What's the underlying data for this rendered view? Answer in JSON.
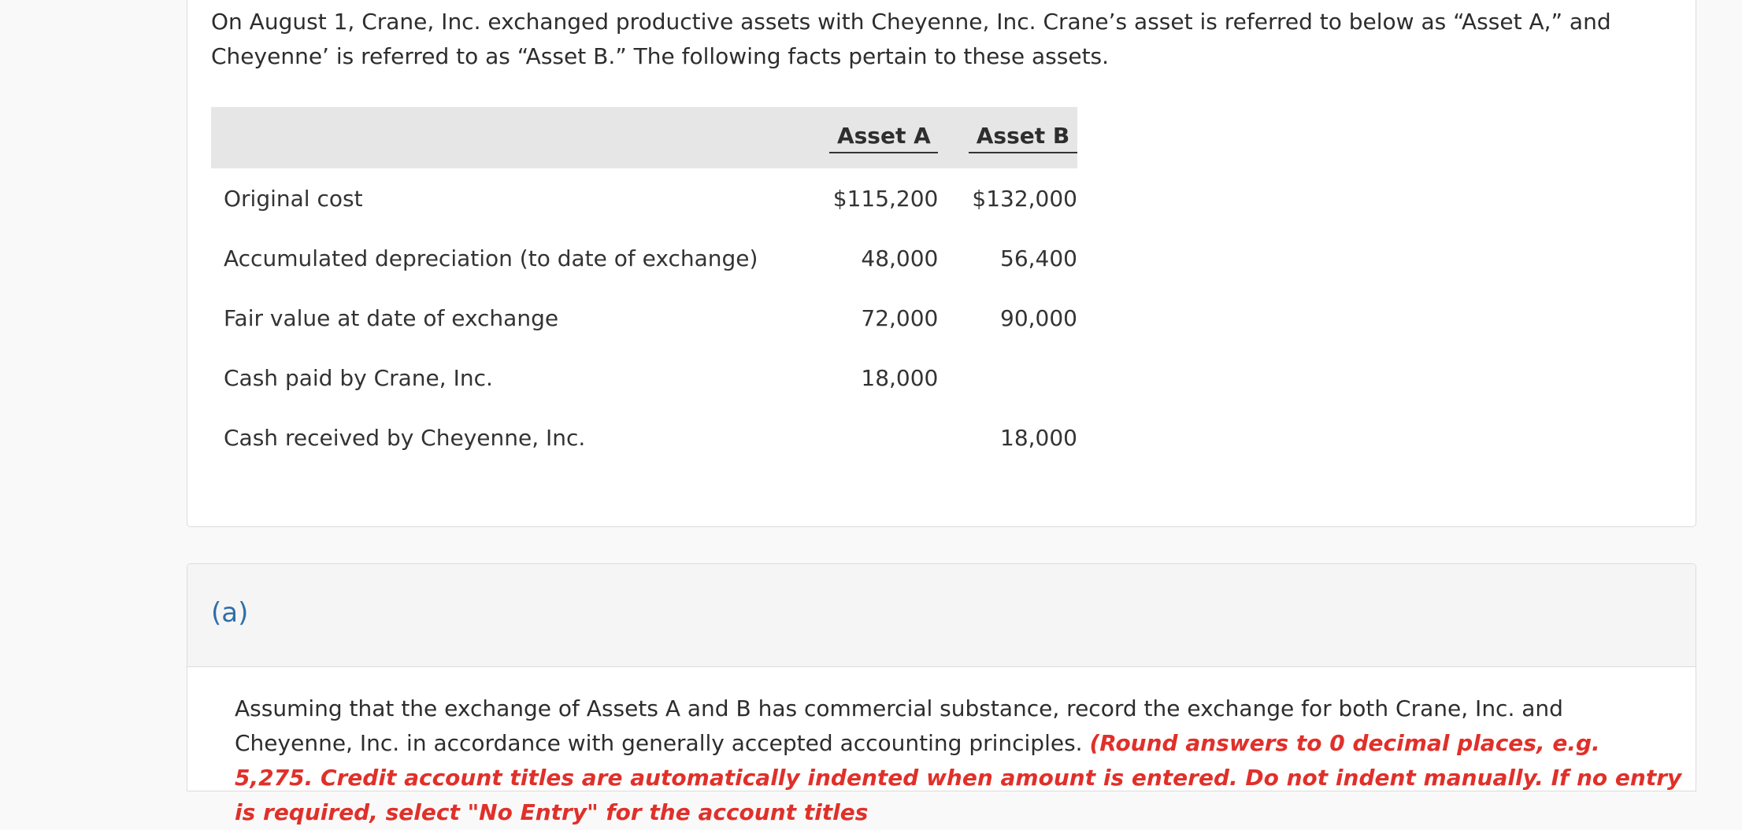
{
  "intro": {
    "text": "On August 1, Crane, Inc. exchanged productive assets with Cheyenne, Inc. Crane’s asset is referred to below as “Asset A,” and Cheyenne’ is referred to as “Asset B.” The following facts pertain to these assets."
  },
  "facts_table": {
    "headers": [
      "",
      "Asset A",
      "Asset B"
    ],
    "rows": [
      {
        "label": "Original cost",
        "a": "$115,200",
        "b": "$132,000"
      },
      {
        "label": "Accumulated depreciation (to date of exchange)",
        "a": "48,000",
        "b": "56,400"
      },
      {
        "label": "Fair value at date of exchange",
        "a": "72,000",
        "b": "90,000"
      },
      {
        "label": "Cash paid by Crane, Inc.",
        "a": "18,000",
        "b": ""
      },
      {
        "label": "Cash received by Cheyenne, Inc.",
        "a": "",
        "b": "18,000"
      }
    ]
  },
  "part_a": {
    "label": "(a)",
    "instructions": "Assuming that the exchange of Assets A and B has commercial substance, record the exchange for both Crane, Inc. and Cheyenne, Inc. in accordance with generally accepted accounting principles.",
    "note": "(Round answers to 0 decimal places, e.g. 5,275. Credit account titles are automatically indented when amount is entered. Do not indent manually. If no entry is required, select \"No Entry\" for the account titles"
  }
}
